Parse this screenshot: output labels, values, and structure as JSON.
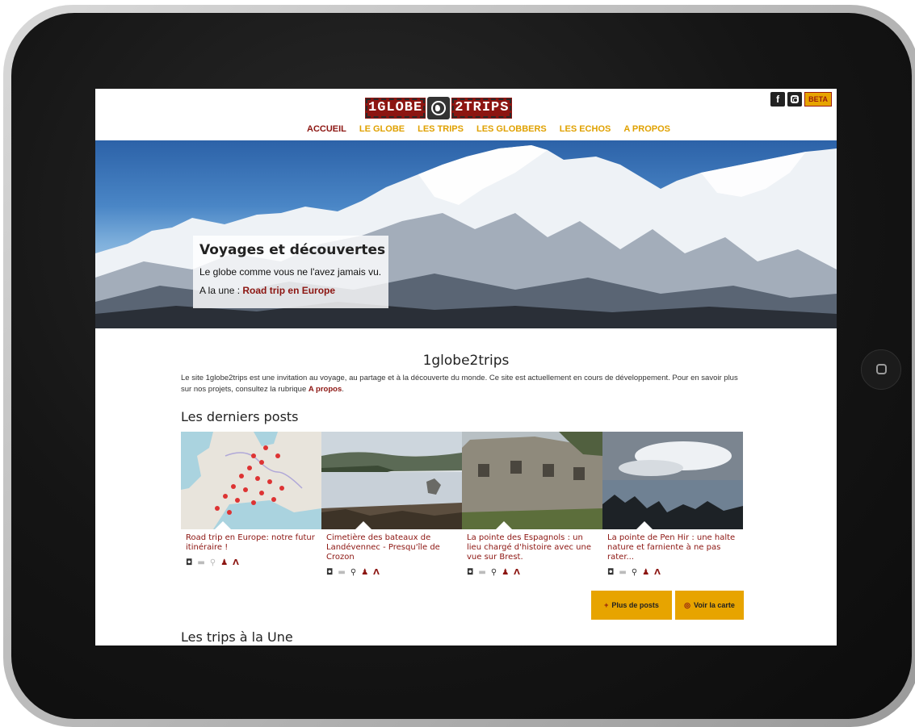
{
  "header": {
    "logo": {
      "part1": "1GLOBE",
      "part2": "2TRIPS"
    },
    "social": {
      "facebook": "f",
      "beta": "BETA"
    },
    "nav": [
      "ACCUEIL",
      "LE GLOBE",
      "LES TRIPS",
      "LES GLOBBERS",
      "LES ECHOS",
      "A PROPOS"
    ]
  },
  "hero": {
    "title": "Voyages et découvertes",
    "subtitle": "Le globe comme vous ne l'avez jamais vu.",
    "une_prefix": "A la une :",
    "une_link": "Road trip en Europe"
  },
  "intro": {
    "title": "1globe2trips",
    "text": "Le site 1globe2trips est une invitation au voyage, au partage et à la découverte du monde. Ce site est actuellement en cours de développement. Pour en savoir plus sur nos projets, consultez la rubrique",
    "link": "A propos",
    "end": "."
  },
  "latest_posts": {
    "heading": "Les derniers posts",
    "items": [
      {
        "title": "Road trip en Europe: notre futur itinéraire !"
      },
      {
        "title": "Cimetière des bateaux de Landévennec - Presqu'île de Crozon"
      },
      {
        "title": "La pointe des Espagnols : un lieu chargé d'histoire avec une vue sur Brest."
      },
      {
        "title": "La pointe de Pen Hir : une halte nature et farniente à ne pas rater..."
      }
    ],
    "more_button": "Plus de posts",
    "map_button": "Voir la carte"
  },
  "featured_trips": {
    "heading": "Les trips à la Une"
  },
  "icons": {
    "plus": "+",
    "globe": "◎",
    "camera": "◘",
    "video": "▬",
    "pin": "⚲",
    "person": "♟",
    "road": "Λ"
  },
  "colors": {
    "accent": "#e7a400",
    "brand": "#8c1511"
  }
}
